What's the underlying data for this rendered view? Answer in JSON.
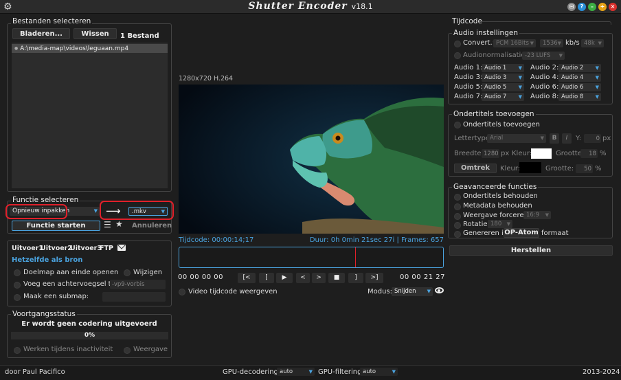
{
  "window": {
    "title": "Shutter Encoder",
    "version": "v18.1",
    "controls": [
      "⊟",
      "?",
      "–",
      "+",
      "×"
    ]
  },
  "files": {
    "section_title": "Bestanden selecteren",
    "browse_label": "Bladeren...",
    "clear_label": "Wissen",
    "count_label": "1 Bestand",
    "items": [
      "A:\\media-map\\videos\\leguaan.mp4"
    ]
  },
  "function": {
    "section_title": "Functie selecteren",
    "selected": "Opnieuw inpakken",
    "format": ".mkv",
    "start_label": "Functie starten",
    "cancel_label": "Annuleren"
  },
  "output": {
    "tabs": [
      "Uitvoer1",
      "Uitvoer2",
      "Uitvoer3",
      "FTP"
    ],
    "same_as_source": "Hetzelfde als bron",
    "open_folder": "Doelmap aan einde openen",
    "replace": "Wijzigen",
    "suffix_label": "Voeg een achtervoegsel toe:",
    "suffix_value": "-vp9-vorbis",
    "subfolder_label": "Maak een submap:"
  },
  "progress": {
    "section_title": "Voortgangsstatus",
    "status": "Er wordt geen codering uitgevoerd",
    "percent": "0%",
    "percent_value": 0,
    "idle_label": "Werken tijdens inactiviteit",
    "display_label": "Weergave"
  },
  "player": {
    "info": "1280x720 H.264",
    "timecode": "Tijdcode: 00:00:14;17",
    "duration": "Duur: 0h 0min 21sec 27i | Frames: 657",
    "position_fraction": 0.667,
    "tc_in": [
      "00",
      "00",
      "00",
      "00"
    ],
    "tc_out": [
      "00",
      "00",
      "21",
      "27"
    ],
    "buttons": [
      "[<",
      "[",
      "▶",
      "<",
      ">",
      "■",
      "]",
      ">]"
    ],
    "show_tc_label": "Video tijdcode weergeven",
    "mode_label": "Modus:",
    "mode_value": "Snijden"
  },
  "timecode_panel": {
    "title": "Tijdcode"
  },
  "audio": {
    "title": "Audio instellingen",
    "convert_label": "Convert.:",
    "codec": "PCM 16Bits",
    "bitrate": "1536",
    "bitrate_unit": "kb/s",
    "rate": "48k",
    "normalize_label": "Audionormalisatie:",
    "lufs": "-23 LUFS",
    "tracks": [
      {
        "label": "Audio 1:",
        "value": "Audio 1"
      },
      {
        "label": "Audio 2:",
        "value": "Audio 2"
      },
      {
        "label": "Audio 3:",
        "value": "Audio 3"
      },
      {
        "label": "Audio 4:",
        "value": "Audio 4"
      },
      {
        "label": "Audio 5:",
        "value": "Audio 5"
      },
      {
        "label": "Audio 6:",
        "value": "Audio 6"
      },
      {
        "label": "Audio 7:",
        "value": "Audio 7"
      },
      {
        "label": "Audio 8:",
        "value": "Audio 8"
      }
    ]
  },
  "subtitles": {
    "title": "Ondertitels toevoegen",
    "add_label": "Ondertitels toevoegen",
    "font_label": "Lettertype:",
    "font_value": "Arial",
    "bold": "B",
    "italic": "I",
    "y_label": "Y:",
    "y_value": "0",
    "px": "px",
    "width_label": "Breedte:",
    "width_value": "1280",
    "color_label": "Kleur:",
    "size_label": "Grootte:",
    "size_value": "18",
    "pct": "%",
    "outline_label": "Omtrek",
    "color2_label": "Kleur:",
    "size2_label": "Grootte:",
    "size2_value": "50"
  },
  "advanced": {
    "title": "Geavanceerde functies",
    "keep_subs": "Ondertitels behouden",
    "keep_meta": "Metadata behouden",
    "force_ratio": "Weergave forceren:",
    "ratio_value": "16:9",
    "rotate": "Rotatie:",
    "rotate_value": "180",
    "generate": "Genereren in",
    "op_atom": "OP-Atom",
    "format_suffix": "formaat",
    "reset_label": "Herstellen"
  },
  "footer": {
    "author": "door Paul Pacifico",
    "gpu_decode_label": "GPU-decodering:",
    "gpu_decode_value": "auto",
    "gpu_filter_label": "GPU-filtering:",
    "gpu_filter_value": "auto",
    "years": "2013-2024"
  },
  "colors": {
    "accent": "#4aa3df",
    "highlight": "#e0202a",
    "background": "#1e1e1e"
  }
}
